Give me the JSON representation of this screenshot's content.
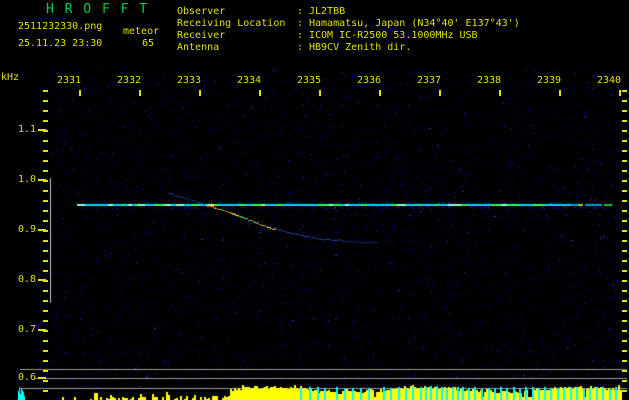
{
  "colors": {
    "title_green": "#00cc44",
    "text_yellow": "#e0e000",
    "noise_blue": "#0000aa",
    "carrier_cyan": "#00d8ff",
    "carrier_green": "#2bff5e",
    "trace_blue": "#2e55d8",
    "trace_hot": [
      "#ff2e1e",
      "#ff8c00",
      "#ffe81c",
      "#2bff5e",
      "#00e0ff"
    ],
    "strip_yellow": "#ffff00",
    "echo_cyan": "#00ffff",
    "grid_gray": "#9a9a9a"
  },
  "header": {
    "title": "H R O F F T",
    "filename": "2511232330.png",
    "mode": "meteor",
    "datetime": "25.11.23 23:30",
    "count": "65",
    "separator": ":",
    "info": [
      {
        "label": "Observer",
        "value": "JL2TBB"
      },
      {
        "label": "Receiving Location",
        "value": "Hamamatsu, Japan (N34°40' E137°43')"
      },
      {
        "label": "Receiver",
        "value": "ICOM IC-R2500 53.1000MHz USB"
      },
      {
        "label": "Antenna",
        "value": "HB9CV Zenith dir."
      }
    ]
  },
  "axes": {
    "freq_unit": "kHz",
    "time_labels": [
      "2331",
      "2332",
      "2333",
      "2334",
      "2335",
      "2336",
      "2337",
      "2338",
      "2339",
      "2340"
    ],
    "freq_labels": [
      "1.1",
      "1.0",
      "0.9",
      "0.8",
      "0.7",
      "0.6"
    ]
  },
  "chart_data": {
    "type": "heatmap",
    "title": "H R O F F T",
    "xlabel": "",
    "ylabel": "kHz",
    "x_ticks": [
      2331,
      2332,
      2333,
      2334,
      2335,
      2336,
      2337,
      2338,
      2339,
      2340
    ],
    "y_ticks_khz": [
      1.1,
      1.0,
      0.9,
      0.8,
      0.7,
      0.6
    ],
    "carrier_line": {
      "freq_khz": 0.95,
      "t_start": 2330.95,
      "t_end": 2339.87
    },
    "meteor_trace": {
      "hot_t_range": [
        2333.08,
        2334.25
      ],
      "points": [
        [
          2332.47,
          0.974
        ],
        [
          2332.63,
          0.968
        ],
        [
          2332.8,
          0.962
        ],
        [
          2332.97,
          0.956
        ],
        [
          2333.12,
          0.95
        ],
        [
          2333.25,
          0.944
        ],
        [
          2333.37,
          0.94
        ],
        [
          2333.5,
          0.934
        ],
        [
          2333.63,
          0.928
        ],
        [
          2333.77,
          0.922
        ],
        [
          2333.9,
          0.916
        ],
        [
          2334.03,
          0.91
        ],
        [
          2334.18,
          0.904
        ],
        [
          2334.33,
          0.9
        ],
        [
          2334.5,
          0.894
        ],
        [
          2334.67,
          0.89
        ],
        [
          2334.83,
          0.886
        ],
        [
          2335.0,
          0.882
        ],
        [
          2335.2,
          0.88
        ],
        [
          2335.4,
          0.878
        ],
        [
          2335.6,
          0.876
        ],
        [
          2335.8,
          0.876
        ],
        [
          2335.97,
          0.874
        ]
      ]
    },
    "signal_strip": {
      "sparse_t_range": [
        2330.67,
        2333.47
      ],
      "dense_t_range": [
        2333.47,
        2340.05
      ],
      "echo_markers_t": [
        2334.67,
        2334.82,
        2334.95,
        2335.07,
        2335.27,
        2335.4,
        2335.53,
        2335.67,
        2335.8,
        2336.05,
        2336.17,
        2336.3,
        2336.42,
        2336.53,
        2336.67,
        2336.75,
        2336.83,
        2336.93,
        2337.02,
        2337.1,
        2337.2,
        2337.28,
        2337.37,
        2337.47,
        2337.57,
        2337.68,
        2337.8,
        2337.9,
        2338.0,
        2338.1,
        2338.22,
        2338.32,
        2338.42,
        2338.53,
        2338.63,
        2338.73,
        2338.83,
        2338.95,
        2339.05,
        2339.17,
        2339.27,
        2339.38,
        2339.48,
        2339.6,
        2339.7,
        2339.82,
        2339.92
      ]
    }
  }
}
